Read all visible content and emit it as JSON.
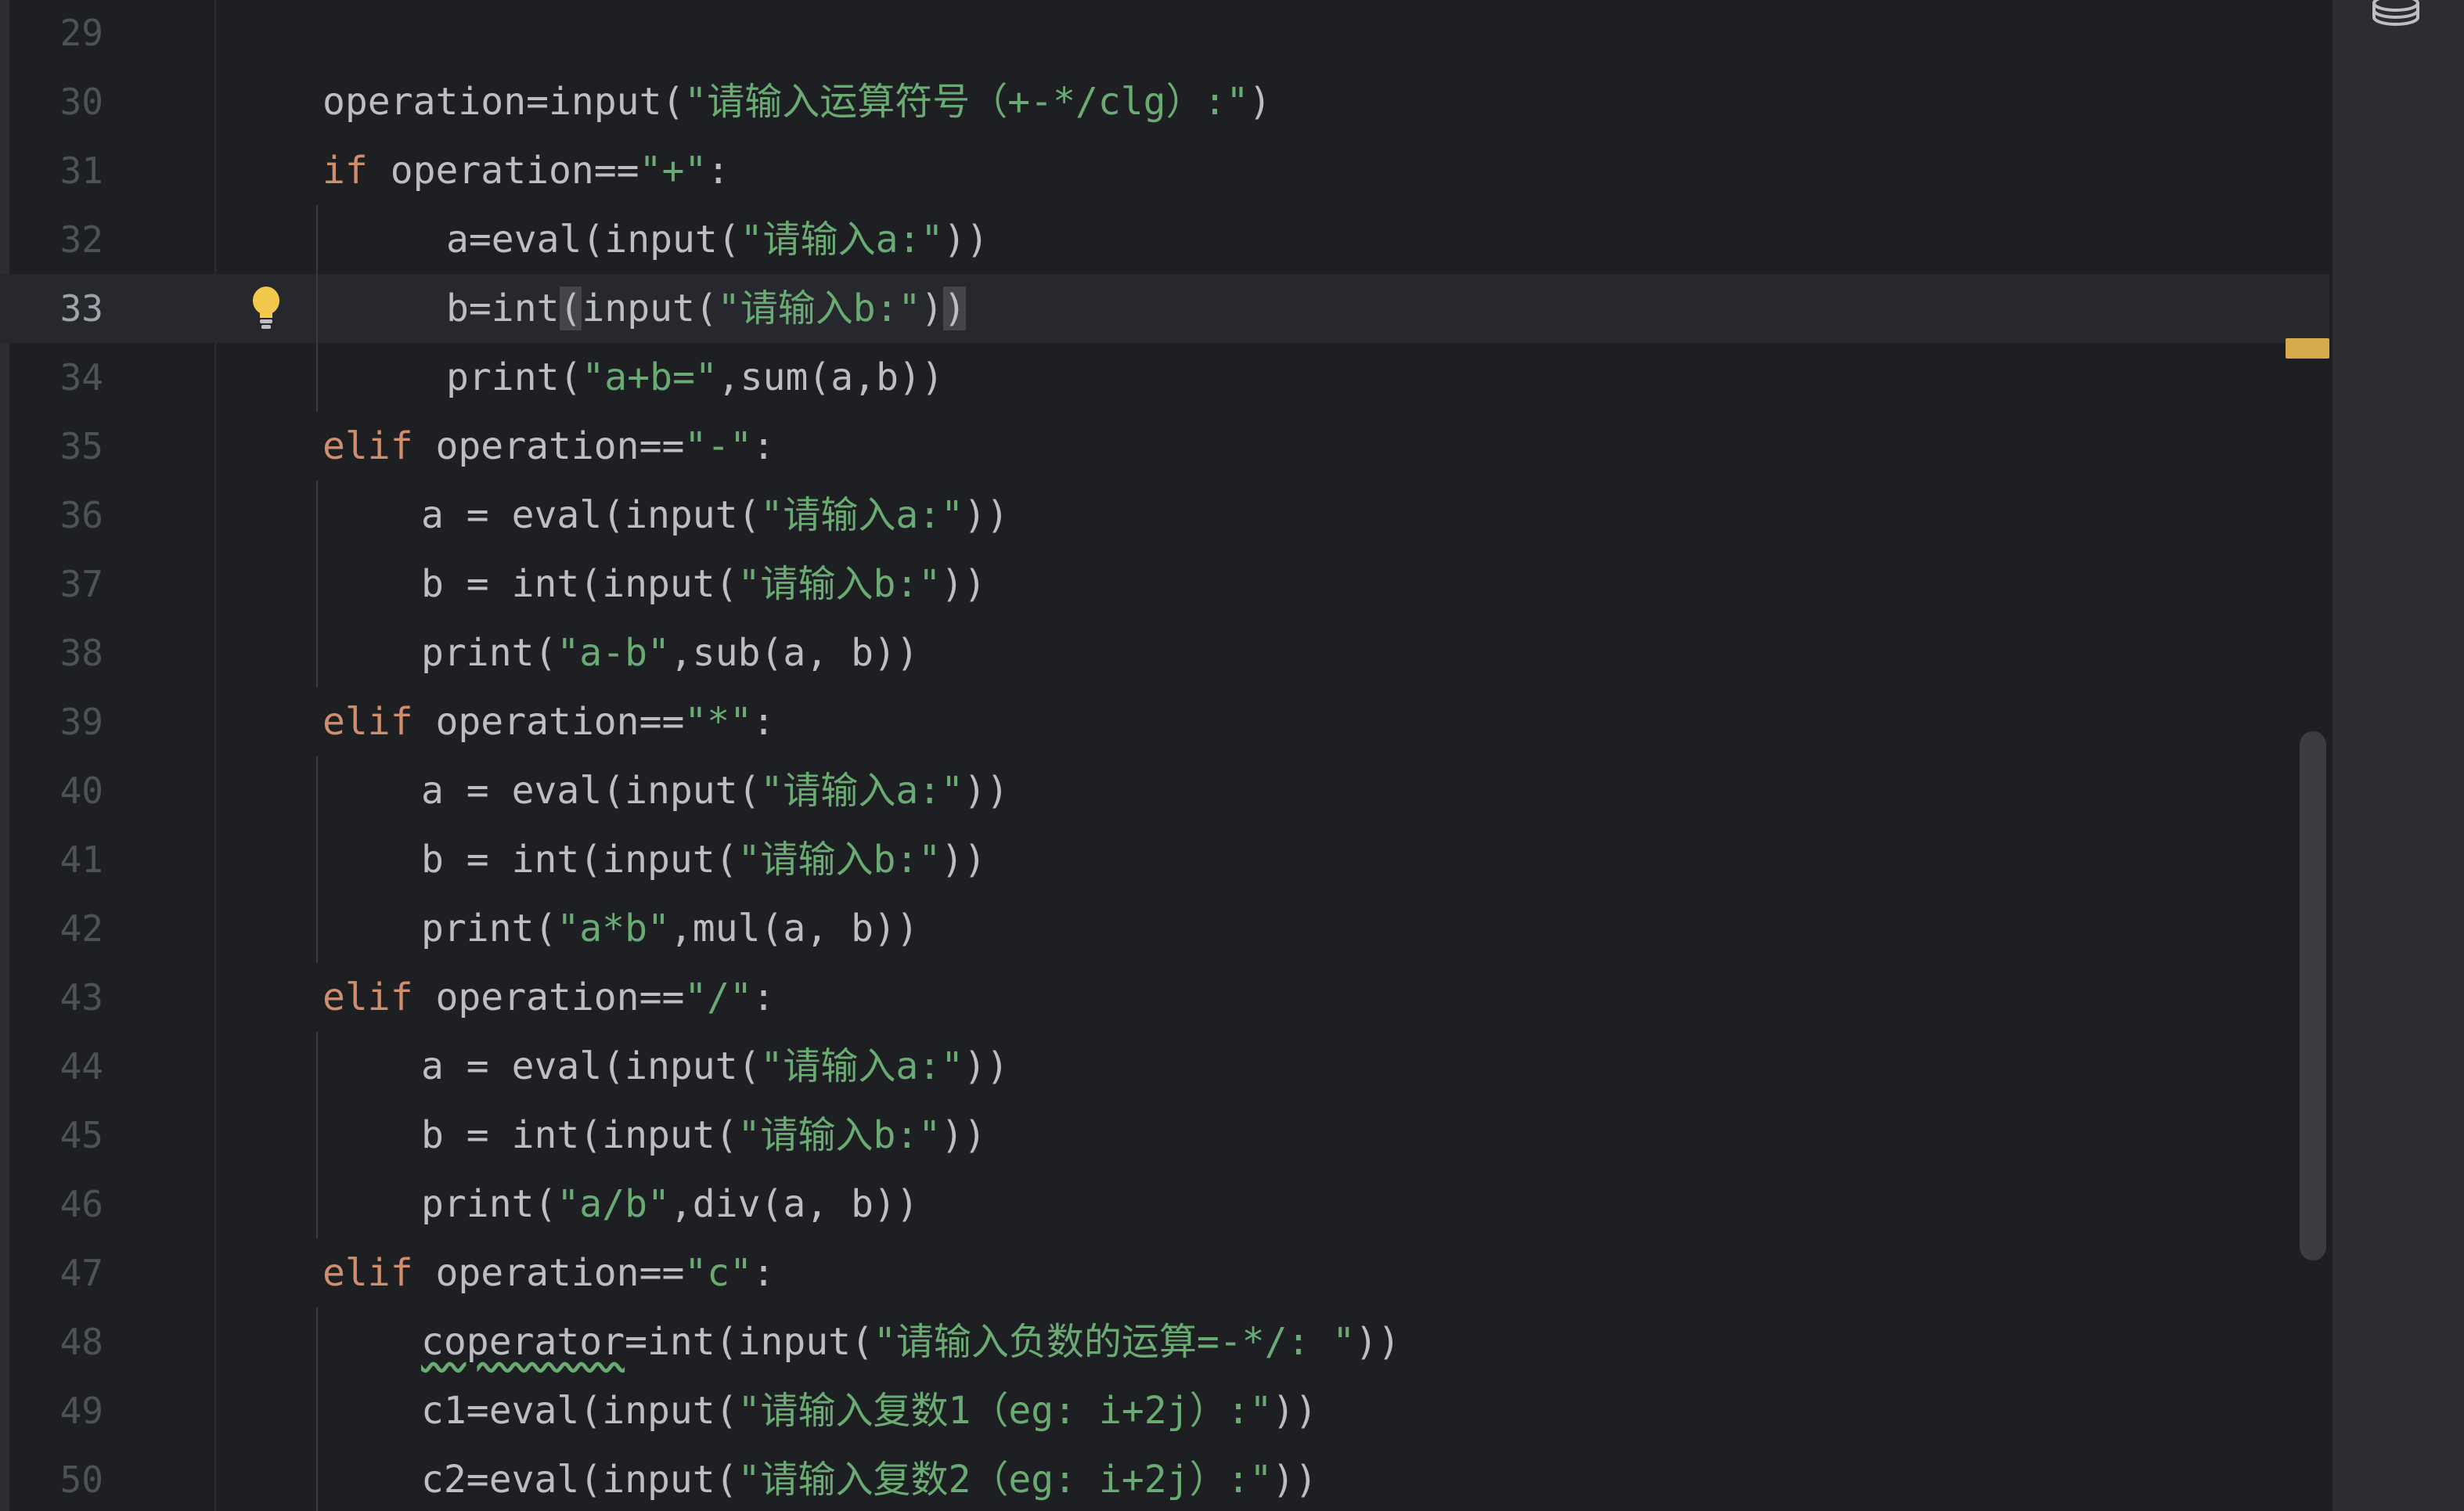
{
  "editor": {
    "current_line": "33",
    "lines": [
      {
        "no": "29",
        "indent": 0,
        "tokens": []
      },
      {
        "no": "30",
        "indent": 1,
        "tokens": [
          {
            "t": "operation=input(",
            "c": "plain"
          },
          {
            "t": "\"请输入运算符号（+-*/clg）:\"",
            "c": "str"
          },
          {
            "t": ")",
            "c": "plain"
          }
        ]
      },
      {
        "no": "31",
        "indent": 1,
        "tokens": [
          {
            "t": "if",
            "c": "kw"
          },
          {
            "t": " operation==",
            "c": "plain"
          },
          {
            "t": "\"+\"",
            "c": "str"
          },
          {
            "t": ":",
            "c": "plain"
          }
        ]
      },
      {
        "no": "32",
        "indent": 2,
        "tokens": [
          {
            "t": "a=eval(input(",
            "c": "plain"
          },
          {
            "t": "\"请输入a:\"",
            "c": "str"
          },
          {
            "t": "))",
            "c": "plain"
          }
        ]
      },
      {
        "no": "33",
        "indent": 2,
        "tokens": [
          {
            "t": "b=int",
            "c": "plain"
          },
          {
            "t": "(",
            "c": "brace"
          },
          {
            "t": "input(",
            "c": "plain"
          },
          {
            "t": "\"请输入b:\"",
            "c": "str"
          },
          {
            "t": ")",
            "c": "plain"
          },
          {
            "t": ")",
            "c": "brace"
          }
        ]
      },
      {
        "no": "34",
        "indent": 2,
        "tokens": [
          {
            "t": "print(",
            "c": "plain"
          },
          {
            "t": "\"a+b=\"",
            "c": "str"
          },
          {
            "t": ",sum(a,b))",
            "c": "plain"
          }
        ]
      },
      {
        "no": "35",
        "indent": 1,
        "tokens": [
          {
            "t": "elif",
            "c": "kw"
          },
          {
            "t": " operation==",
            "c": "plain"
          },
          {
            "t": "\"-\"",
            "c": "str"
          },
          {
            "t": ":",
            "c": "plain"
          }
        ]
      },
      {
        "no": "36",
        "indent": 3,
        "tokens": [
          {
            "t": "a = eval(input(",
            "c": "plain"
          },
          {
            "t": "\"请输入a:\"",
            "c": "str"
          },
          {
            "t": "))",
            "c": "plain"
          }
        ]
      },
      {
        "no": "37",
        "indent": 3,
        "tokens": [
          {
            "t": "b = int(input(",
            "c": "plain"
          },
          {
            "t": "\"请输入b:\"",
            "c": "str"
          },
          {
            "t": "))",
            "c": "plain"
          }
        ]
      },
      {
        "no": "38",
        "indent": 3,
        "tokens": [
          {
            "t": "print(",
            "c": "plain"
          },
          {
            "t": "\"a-b\"",
            "c": "str"
          },
          {
            "t": ",sub(a, b))",
            "c": "plain"
          }
        ]
      },
      {
        "no": "39",
        "indent": 1,
        "tokens": [
          {
            "t": "elif",
            "c": "kw"
          },
          {
            "t": " operation==",
            "c": "plain"
          },
          {
            "t": "\"*\"",
            "c": "str"
          },
          {
            "t": ":",
            "c": "plain"
          }
        ]
      },
      {
        "no": "40",
        "indent": 3,
        "tokens": [
          {
            "t": "a = eval(input(",
            "c": "plain"
          },
          {
            "t": "\"请输入a:\"",
            "c": "str"
          },
          {
            "t": "))",
            "c": "plain"
          }
        ]
      },
      {
        "no": "41",
        "indent": 3,
        "tokens": [
          {
            "t": "b = int(input(",
            "c": "plain"
          },
          {
            "t": "\"请输入b:\"",
            "c": "str"
          },
          {
            "t": "))",
            "c": "plain"
          }
        ]
      },
      {
        "no": "42",
        "indent": 3,
        "tokens": [
          {
            "t": "print(",
            "c": "plain"
          },
          {
            "t": "\"a*b\"",
            "c": "str"
          },
          {
            "t": ",mul(a, b))",
            "c": "plain"
          }
        ]
      },
      {
        "no": "43",
        "indent": 1,
        "tokens": [
          {
            "t": "elif",
            "c": "kw"
          },
          {
            "t": " operation==",
            "c": "plain"
          },
          {
            "t": "\"/\"",
            "c": "str"
          },
          {
            "t": ":",
            "c": "plain"
          }
        ]
      },
      {
        "no": "44",
        "indent": 3,
        "tokens": [
          {
            "t": "a = eval(input(",
            "c": "plain"
          },
          {
            "t": "\"请输入a:\"",
            "c": "str"
          },
          {
            "t": "))",
            "c": "plain"
          }
        ]
      },
      {
        "no": "45",
        "indent": 3,
        "tokens": [
          {
            "t": "b = int(input(",
            "c": "plain"
          },
          {
            "t": "\"请输入b:\"",
            "c": "str"
          },
          {
            "t": "))",
            "c": "plain"
          }
        ]
      },
      {
        "no": "46",
        "indent": 3,
        "tokens": [
          {
            "t": "print(",
            "c": "plain"
          },
          {
            "t": "\"a/b\"",
            "c": "str"
          },
          {
            "t": ",div(a, b))",
            "c": "plain"
          }
        ]
      },
      {
        "no": "47",
        "indent": 1,
        "tokens": [
          {
            "t": "elif",
            "c": "kw"
          },
          {
            "t": " operation==",
            "c": "plain"
          },
          {
            "t": "\"c\"",
            "c": "str"
          },
          {
            "t": ":",
            "c": "plain"
          }
        ]
      },
      {
        "no": "48",
        "indent": 3,
        "tokens": [
          {
            "t": "coperator",
            "c": "wavy"
          },
          {
            "t": "=int(input(",
            "c": "plain"
          },
          {
            "t": "\"请输入负数的运算=-*/: \"",
            "c": "str"
          },
          {
            "t": "))",
            "c": "plain"
          }
        ]
      },
      {
        "no": "49",
        "indent": 3,
        "tokens": [
          {
            "t": "c1=eval(input(",
            "c": "plain"
          },
          {
            "t": "\"请输入复数1（eg: i+2j）:\"",
            "c": "str"
          },
          {
            "t": "))",
            "c": "plain"
          }
        ]
      },
      {
        "no": "50",
        "indent": 3,
        "tokens": [
          {
            "t": "c2=eval(input(",
            "c": "plain"
          },
          {
            "t": "\"请输入复数2（eg: i+2j）:\"",
            "c": "str"
          },
          {
            "t": "))",
            "c": "plain"
          }
        ]
      }
    ]
  },
  "icons": {
    "intention": "lightbulb-icon",
    "database": "database-icon"
  },
  "colors": {
    "background": "#1e1f22",
    "keyword": "#cf8e6d",
    "string": "#6aab73",
    "plain": "#bcbec4",
    "line_number": "#4e5157",
    "warning_marker": "#d6a94a"
  }
}
